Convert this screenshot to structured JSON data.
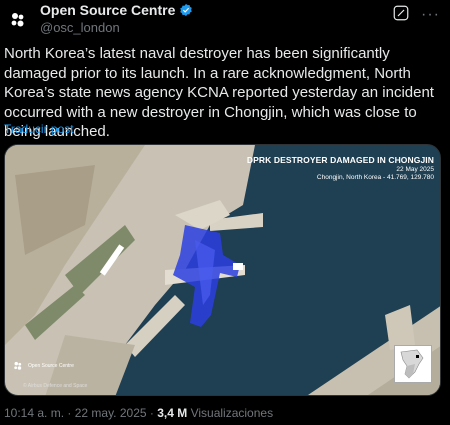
{
  "account": {
    "display_name": "Open Source Centre",
    "handle": "@osc_london",
    "avatar_icon": "osc-logo-icon",
    "verified_icon": "verified-badge-icon"
  },
  "header_actions": {
    "grok_icon": "grok-icon",
    "more_label": "···"
  },
  "tweet": {
    "text": "North Korea’s latest naval destroyer has been significantly damaged prior to its launch. In a rare acknowledgment, North Korea’s state news agency KCNA reported yesterday an incident occurred with a new destroyer in Chongjin, which was close to being launched.",
    "translate_label": "Traducir post"
  },
  "media": {
    "title": "DPRK DESTROYER DAMAGED IN CHONGJIN",
    "date": "22 May 2025",
    "location": "Chongjin, North Korea - 41.769, 129.780",
    "logo_text": "Open Source Centre",
    "credit": "© Airbus Defence and Space",
    "colors": {
      "water": "#1f3f52",
      "land": "#c9c2b4",
      "highlight": "#2b3fe0"
    }
  },
  "meta": {
    "time": "10:14 a. m.",
    "separator": " · ",
    "date": "22 may. 2025",
    "views_count": "3,4 M",
    "views_label": "Visualizaciones"
  }
}
